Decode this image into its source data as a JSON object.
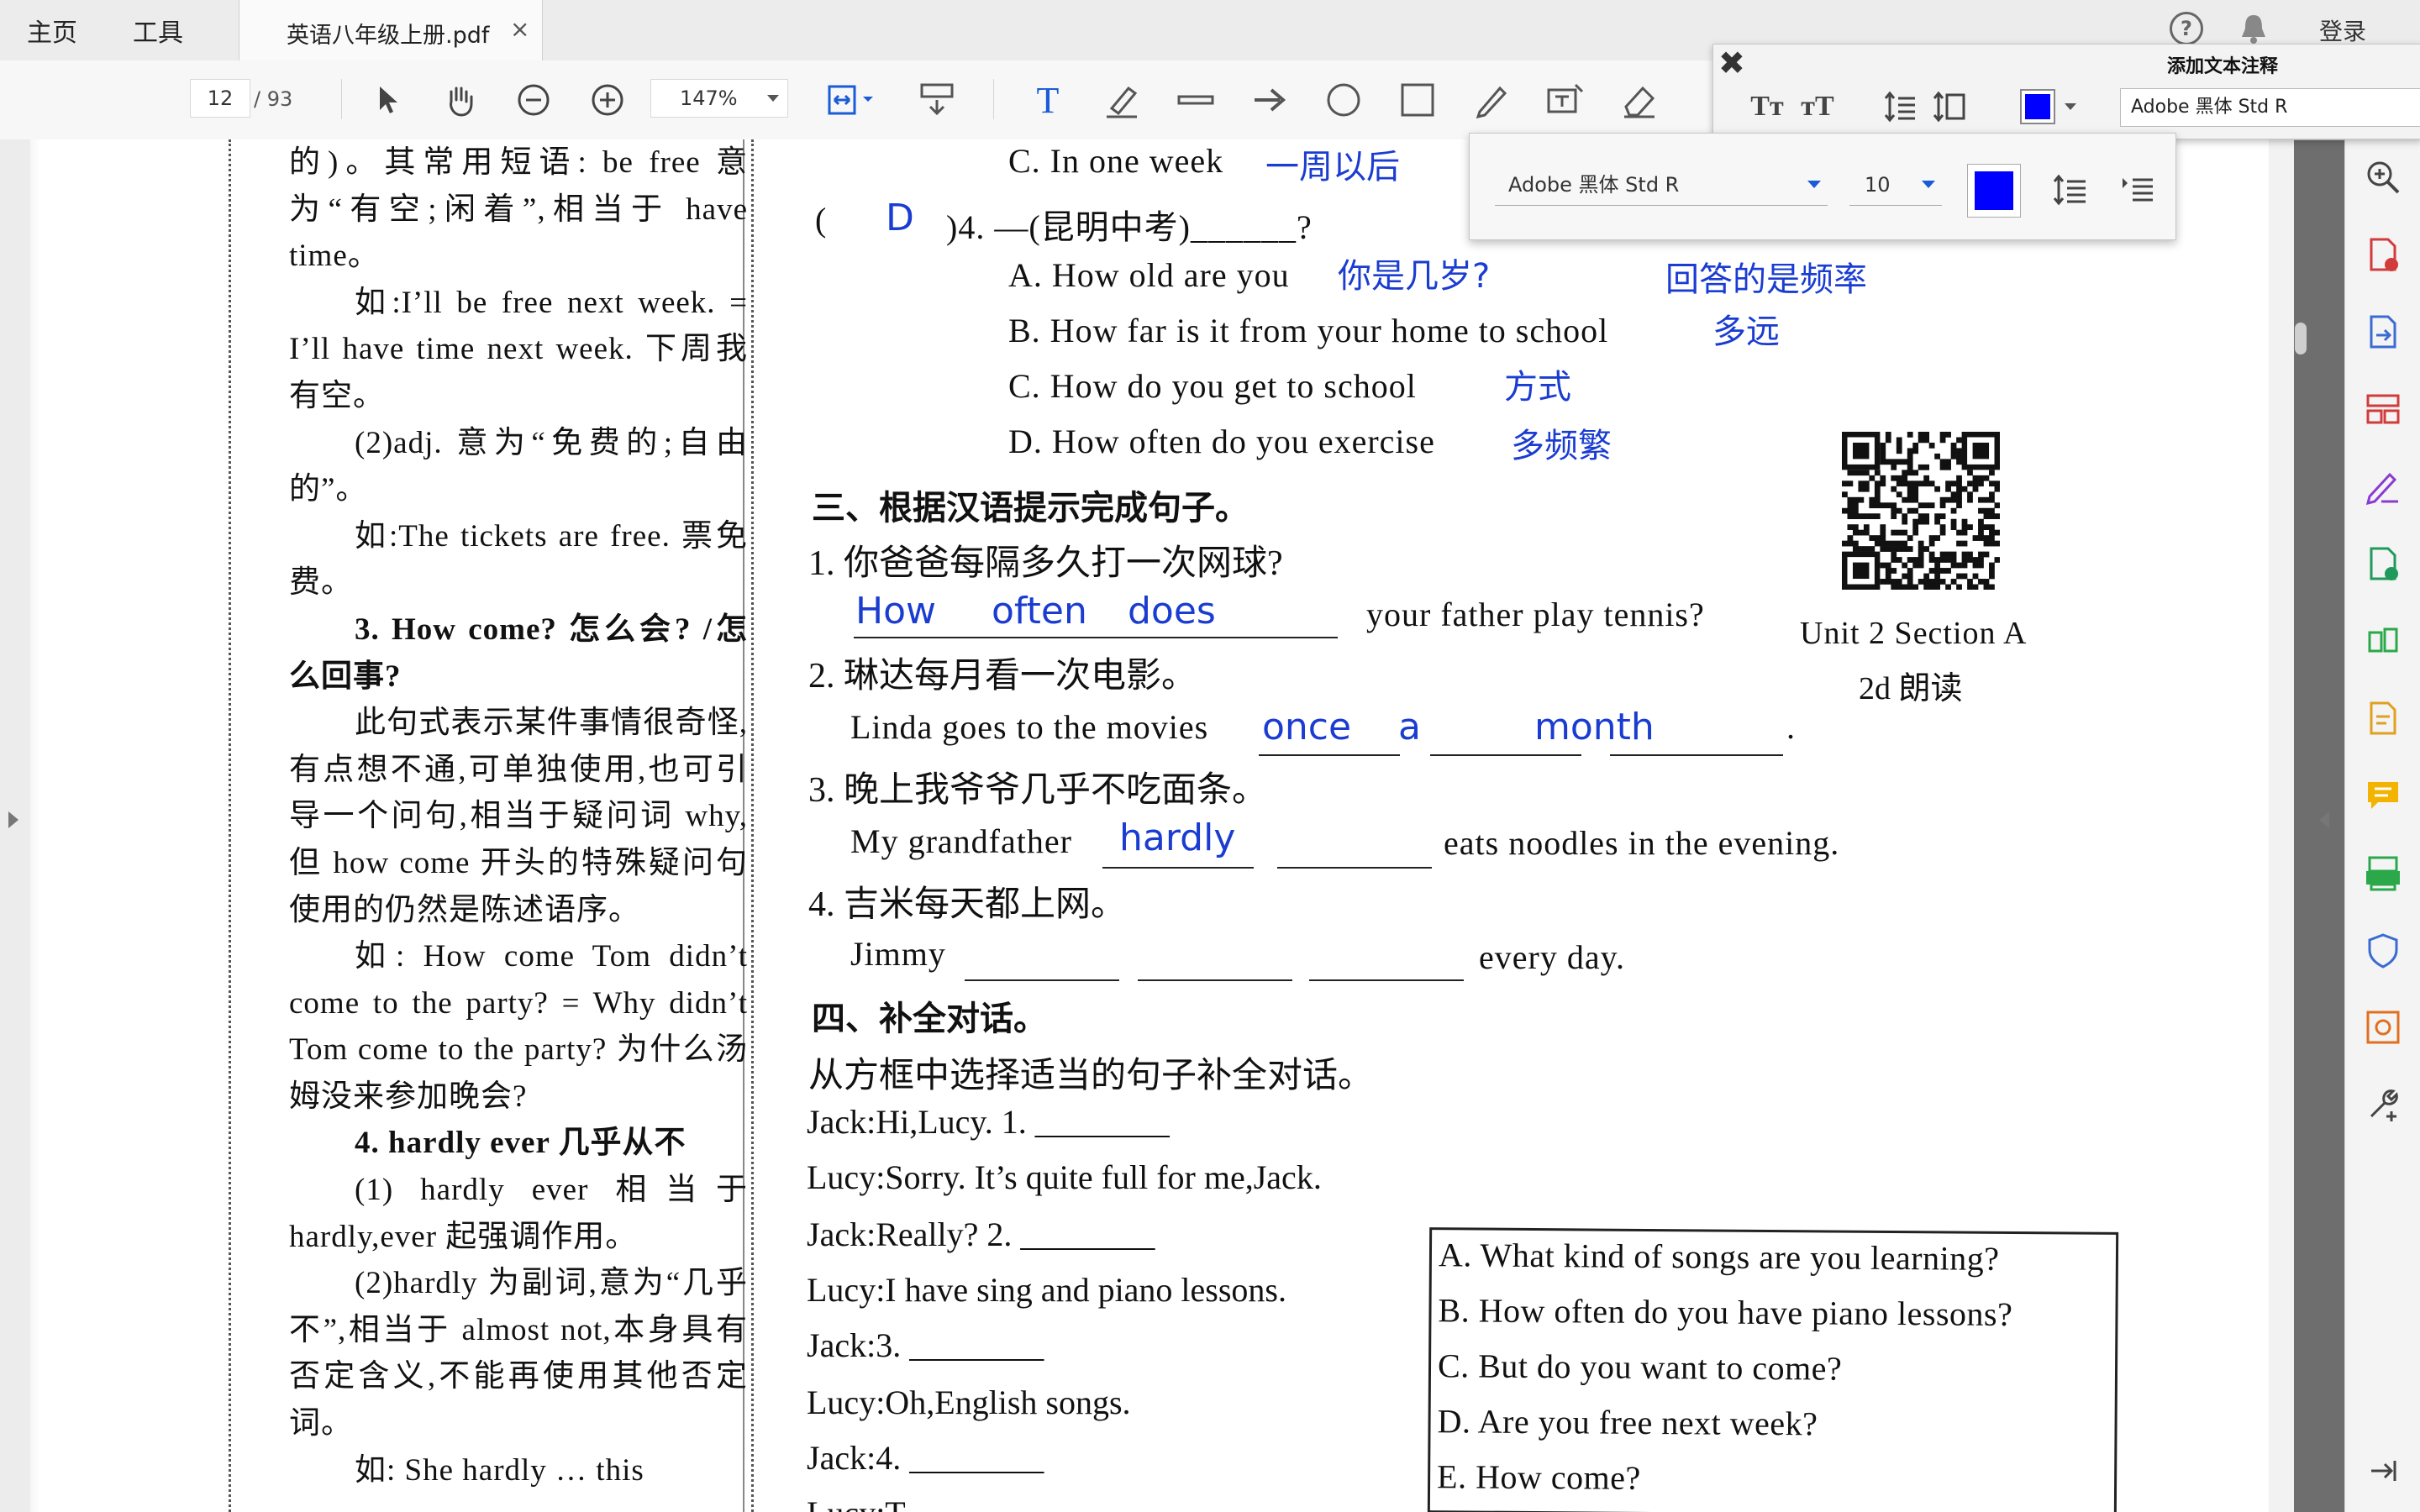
{
  "tabs": {
    "home": "主页",
    "tools": "工具",
    "doc": "英语八年级上册.pdf",
    "close": "×",
    "login": "登录"
  },
  "toolbar": {
    "page_current": "12",
    "page_total": "/ 93",
    "zoom": "147%"
  },
  "annotation_panel": {
    "title": "添加文本注释",
    "font": "Adobe 黑体 Std R",
    "close": "✖"
  },
  "font_popover": {
    "font": "Adobe 黑体 Std R",
    "size": "10",
    "color": "#0000ff"
  },
  "left_column": [
    "的)。其常用短语: be free 意为“有空;闲着”,相当于 have time。",
    "如:I’ll be free next week. = I’ll have time next week. 下周我有空。",
    "(2)adj. 意为“免费的;自由的”。",
    "如:The tickets are free. 票免费。",
    "3. How come? 怎么会? /怎么回事?",
    "此句式表示某件事情很奇怪,有点想不通,可单独使用,也可引导一个问句,相当于疑问词 why,但 how come 开头的特殊疑问句使用的仍然是陈述语序。",
    "如: How come Tom didn’t come to the party? = Why didn’t Tom come to the party? 为什么汤姆没来参加晚会?",
    "4. hardly ever 几乎从不",
    "(1) hardly ever 相当于 hardly,ever 起强调作用。",
    "(2)hardly 为副词,意为“几乎不”,相当于 almost not,本身具有否定含义,不能再使用其他否定词。",
    "如: She hardly … this"
  ],
  "q3c": {
    "text": "C. In one week",
    "note": "一周以后"
  },
  "q4": {
    "paren_open": "(",
    "answer": "D",
    "text": ")4. —(昆明中考)______?",
    "dash": "—"
  },
  "q4_options": [
    {
      "text": "A. How old are you",
      "note": "你是几岁?"
    },
    {
      "text": "B. How far is it from your home to school",
      "note": "多远"
    },
    {
      "text": "C. How do you get to school",
      "note": "方式"
    },
    {
      "text": "D. How often do you exercise",
      "note": "多频繁"
    }
  ],
  "q4_extra_note": "回答的是频率",
  "section3": {
    "heading": "三、根据汉语提示完成句子。",
    "items": [
      {
        "cn": "1. 你爸爸每隔多久打一次网球?",
        "en_after": "your father play tennis?",
        "answers": [
          "How",
          "often",
          "does"
        ]
      },
      {
        "cn": "2. 琳达每月看一次电影。",
        "en_before": "Linda goes to the movies",
        "answers": [
          "once",
          "a",
          "month"
        ],
        "end": "."
      },
      {
        "cn": "3. 晚上我爷爷几乎不吃面条。",
        "en_before": "My grandfather",
        "answers": [
          "hardly"
        ],
        "en_after": "eats noodles in the evening."
      },
      {
        "cn": "4. 吉米每天都上网。",
        "en_before": "Jimmy",
        "en_after": "every day."
      }
    ]
  },
  "qr_caption": {
    "line1": "Unit 2 Section A",
    "line2": "2d 朗读"
  },
  "section4": {
    "heading": "四、补全对话。",
    "instruction": "从方框中选择适当的句子补全对话。",
    "dialog": [
      "Jack:Hi,Lucy. 1. ________",
      "Lucy:Sorry. It’s quite full for me,Jack.",
      "Jack:Really? 2. ________",
      "Lucy:I have sing and piano lessons.",
      "Jack:3. ________",
      "Lucy:Oh,English songs.",
      "Jack:4. ________",
      "Lucy:T..."
    ],
    "options": [
      "A. What kind of songs are you learning?",
      "B. How often do you have piano lessons?",
      "C. But do you want to come?",
      "D. Are you free next week?",
      "E. How come?"
    ]
  }
}
